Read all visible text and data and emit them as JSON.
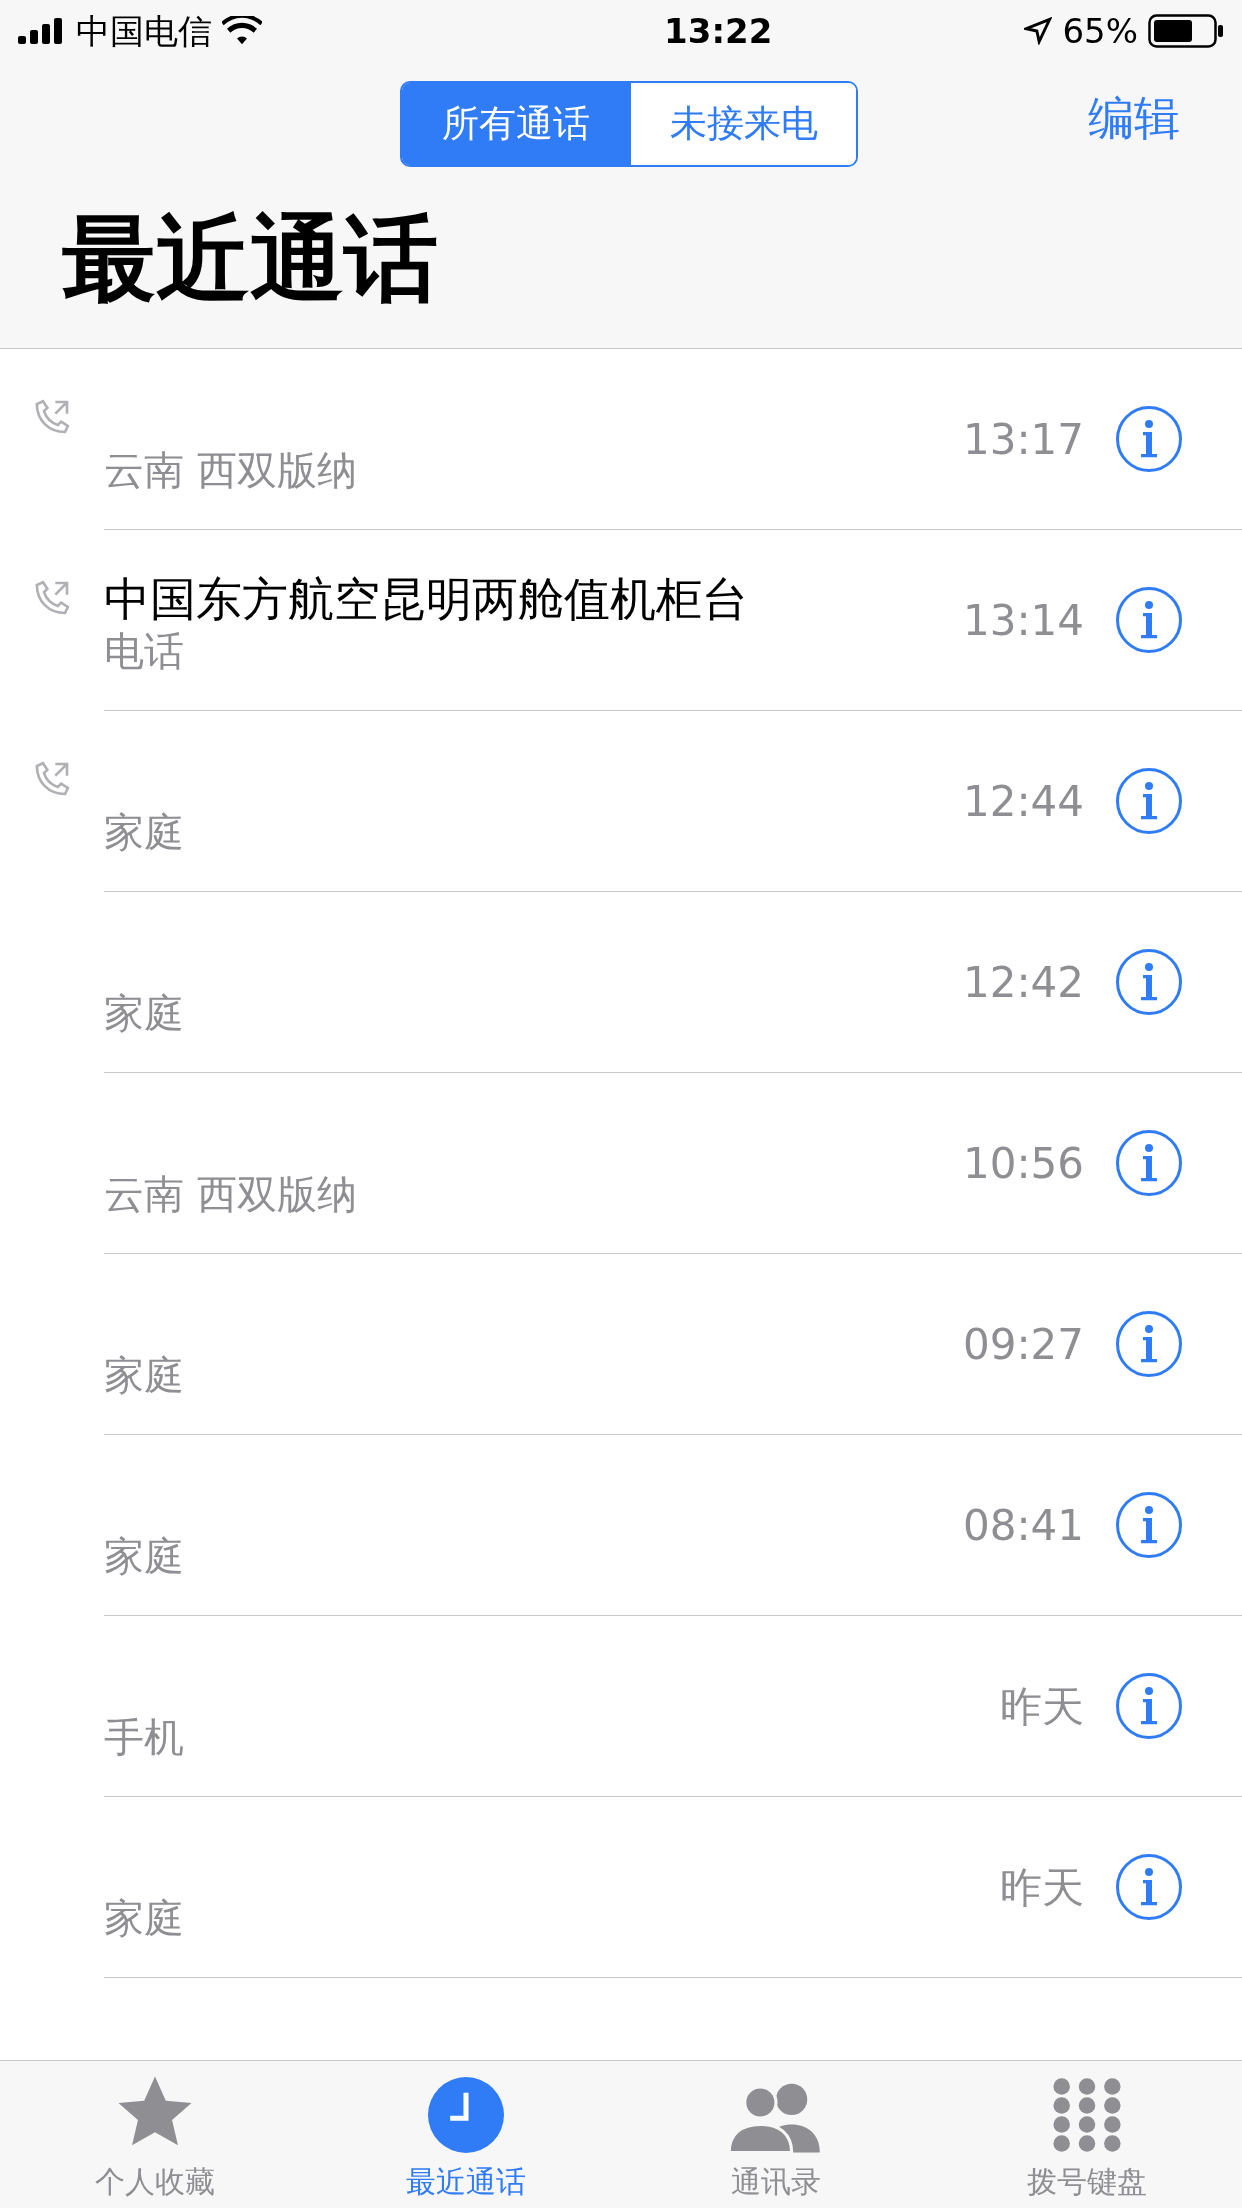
{
  "status_bar": {
    "carrier": "中国电信",
    "time": "13:22",
    "battery": "65%"
  },
  "segments": [
    {
      "label": "所有通话",
      "selected": true
    },
    {
      "label": "未接来电",
      "selected": false
    }
  ],
  "edit_button": "编辑",
  "title": "最近通话",
  "calls": [
    {
      "outgoing": true,
      "subtitle": "云南 西双版纳",
      "time": "13:17"
    },
    {
      "outgoing": true,
      "name": "中国东方航空昆明两舱值机柜台",
      "subtitle": "电话",
      "time": "13:14"
    },
    {
      "outgoing": true,
      "subtitle": "家庭",
      "time": "12:44"
    },
    {
      "outgoing": false,
      "subtitle": "家庭",
      "time": "12:42"
    },
    {
      "outgoing": false,
      "subtitle": "云南 西双版纳",
      "time": "10:56"
    },
    {
      "outgoing": false,
      "subtitle": "家庭",
      "time": "09:27"
    },
    {
      "outgoing": false,
      "subtitle": "家庭",
      "time": "08:41"
    },
    {
      "outgoing": false,
      "subtitle": "手机",
      "time": "昨天"
    },
    {
      "outgoing": false,
      "subtitle": "家庭",
      "time": "昨天"
    }
  ],
  "tabs": [
    {
      "kind": "favorites",
      "label": "个人收藏",
      "selected": false
    },
    {
      "kind": "recents",
      "label": "最近通话",
      "selected": true
    },
    {
      "kind": "contacts",
      "label": "通讯录",
      "selected": false
    },
    {
      "kind": "keypad",
      "label": "拨号键盘",
      "selected": false
    }
  ]
}
